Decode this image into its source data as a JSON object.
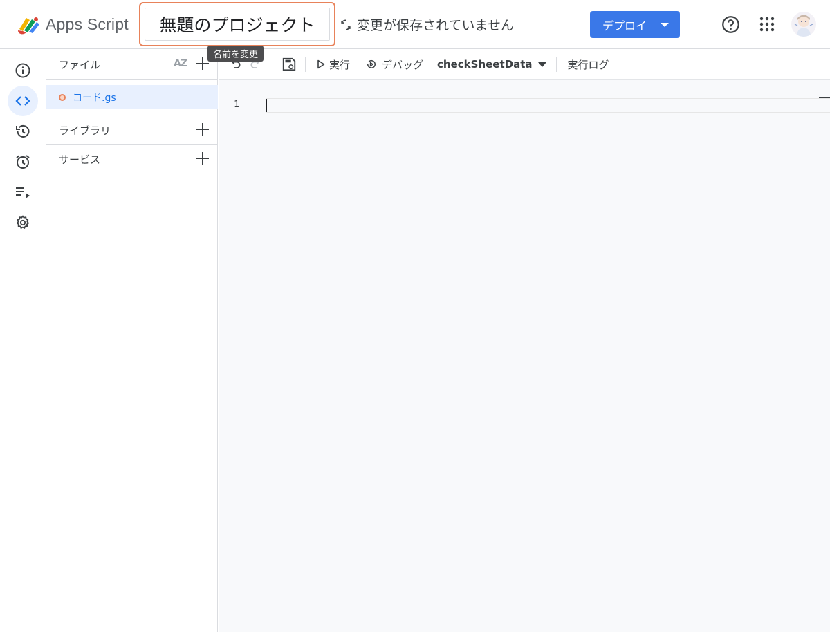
{
  "header": {
    "app_name": "Apps Script",
    "project_title": "無題のプロジェクト",
    "save_status": "変更が保存されていません",
    "deploy_label": "デプロイ"
  },
  "tooltip": {
    "text": "名前を変更"
  },
  "rail": {
    "items": [
      {
        "name": "overview",
        "icon": "info-icon"
      },
      {
        "name": "editor",
        "icon": "code-icon",
        "active": true
      },
      {
        "name": "history",
        "icon": "history-icon"
      },
      {
        "name": "triggers",
        "icon": "alarm-icon"
      },
      {
        "name": "executions",
        "icon": "executions-icon"
      },
      {
        "name": "settings",
        "icon": "gear-icon"
      }
    ]
  },
  "files_panel": {
    "files_label": "ファイル",
    "sort_icon_text": "AZ",
    "files": [
      {
        "name": "コード.gs"
      }
    ],
    "libraries_label": "ライブラリ",
    "services_label": "サービス"
  },
  "toolbar": {
    "run_label": "実行",
    "debug_label": "デバッグ",
    "function_name": "checkSheetData",
    "log_label": "実行ログ"
  },
  "editor": {
    "line_numbers": [
      "1"
    ]
  },
  "colors": {
    "accent": "#3a78e8",
    "title_highlight": "#e8825a",
    "active_bg": "#e8f0fe",
    "link": "#1a73e8"
  }
}
